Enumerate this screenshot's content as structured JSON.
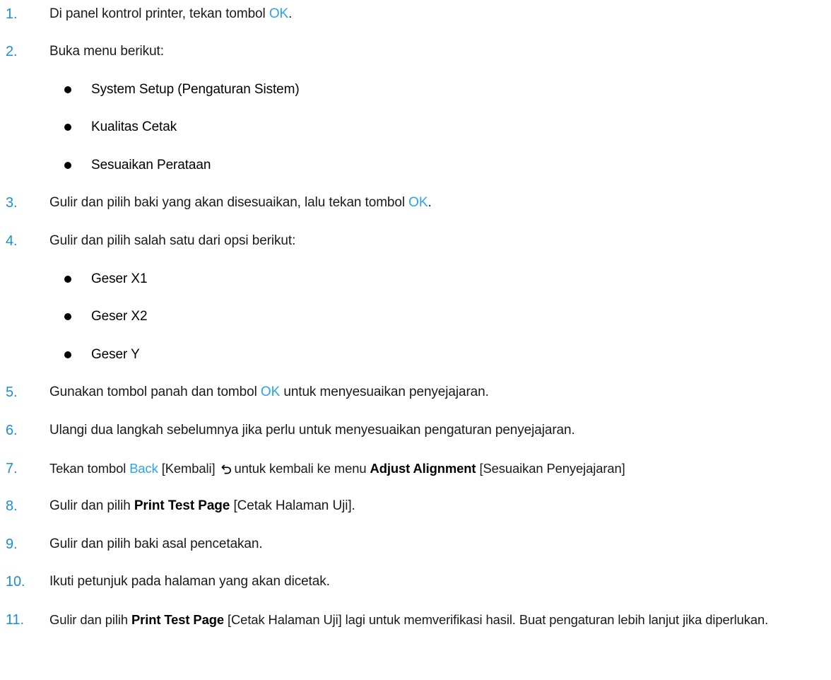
{
  "steps": [
    {
      "num": "1.",
      "a": "Di panel kontrol printer, tekan tombol ",
      "link": "OK",
      "b": "."
    },
    {
      "num": "2.",
      "text": "Buka menu berikut:"
    },
    {
      "num": "3.",
      "a": "Gulir dan pilih baki yang akan disesuaikan, lalu tekan tombol ",
      "link": "OK",
      "b": "."
    },
    {
      "num": "4.",
      "text": "Gulir dan pilih salah satu dari opsi berikut:"
    },
    {
      "num": "5.",
      "a": "Gunakan tombol panah dan tombol ",
      "link": "OK",
      "b": " untuk menyesuaikan penyejajaran."
    },
    {
      "num": "6.",
      "text": "Ulangi dua langkah sebelumnya jika perlu untuk menyesuaikan pengaturan penyejajaran."
    },
    {
      "num": "7.",
      "a": "Tekan tombol ",
      "link": "Back",
      "b": " [Kembali] ",
      "c": "untuk kembali ke menu ",
      "bold": "Adjust Alignment",
      "d": " [Sesuaikan Penyejajaran]"
    },
    {
      "num": "8.",
      "a": "Gulir dan pilih ",
      "bold": "Print Test Page",
      "b": " [Cetak Halaman Uji]."
    },
    {
      "num": "9.",
      "text": "Gulir dan pilih baki asal pencetakan."
    },
    {
      "num": "10.",
      "text": "Ikuti petunjuk pada halaman yang akan dicetak."
    },
    {
      "num": "11.",
      "a": "Gulir dan pilih ",
      "bold": "Print Test Page",
      "b": " [Cetak Halaman Uji] lagi untuk memverifikasi hasil. Buat pengaturan lebih lanjut jika diperlukan."
    }
  ],
  "menu_items": [
    "System Setup (Pengaturan Sistem)",
    "Kualitas Cetak",
    "Sesuaikan Perataan"
  ],
  "option_items": [
    "Geser X1",
    "Geser X2",
    "Geser Y"
  ],
  "icons": {
    "back": "back-arrow-icon"
  },
  "colors": {
    "step_number": "#1a8fd6",
    "link": "#2aa3e8",
    "text": "#1a1a1a"
  }
}
